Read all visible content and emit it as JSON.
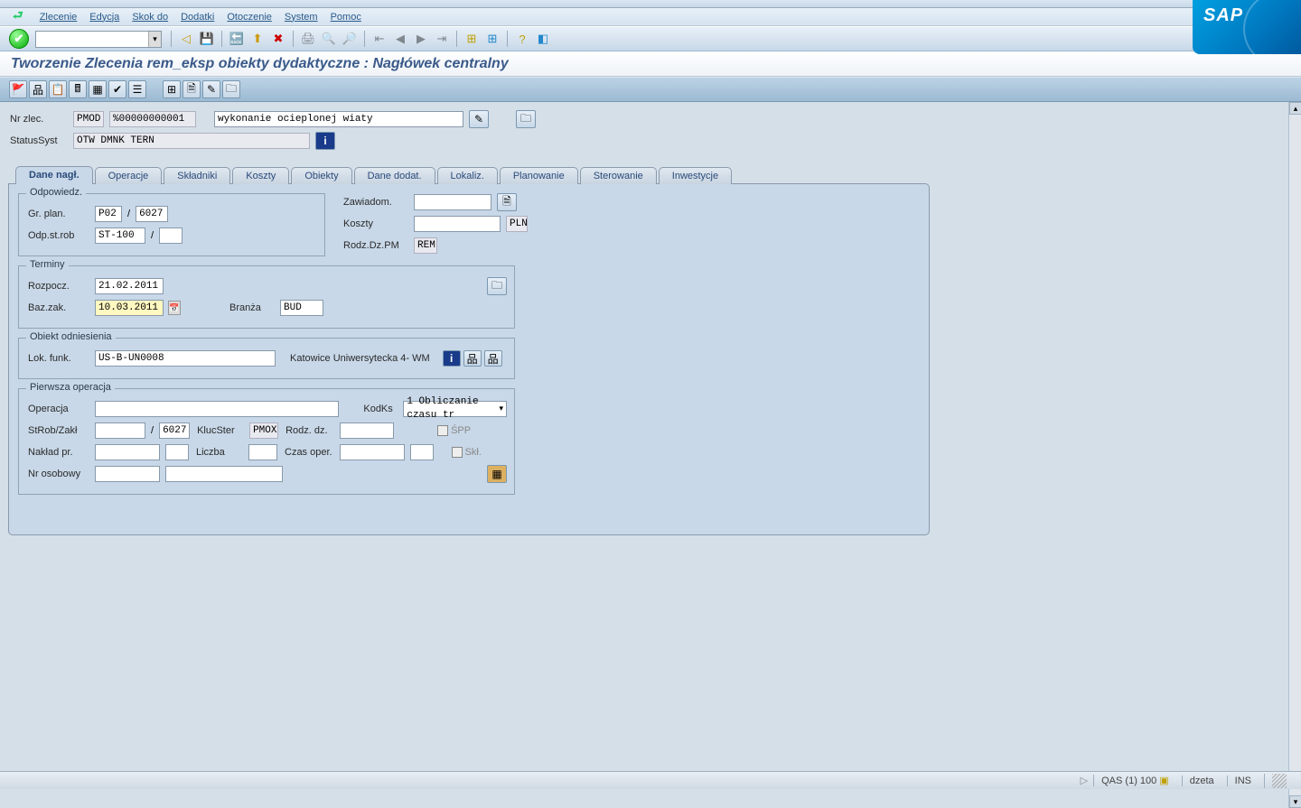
{
  "menu": {
    "items": [
      "Zlecenie",
      "Edycja",
      "Skok do",
      "Dodatki",
      "Otoczenie",
      "System",
      "Pomoc"
    ]
  },
  "page_title": "Tworzenie Zlecenia rem_eksp obiekty dydaktyczne : Nagłówek centralny",
  "header": {
    "nr_zlec_label": "Nr zlec.",
    "nr_zlec_type": "PMOD",
    "nr_zlec_num": "%00000000001",
    "nr_zlec_desc": "wykonanie ocieplonej wiaty",
    "status_label": "StatusSyst",
    "status_value": "OTW  DMNK TERN"
  },
  "tabs": [
    "Dane nagł.",
    "Operacje",
    "Składniki",
    "Koszty",
    "Obiekty",
    "Dane dodat.",
    "Lokaliz.",
    "Planowanie",
    "Sterowanie",
    "Inwestycje"
  ],
  "odpowiedz": {
    "title": "Odpowiedz.",
    "gr_plan_label": "Gr. plan.",
    "gr_plan_1": "P02",
    "gr_plan_2": "6027",
    "odp_strob_label": "Odp.st.rob",
    "odp_strob_1": "ST-100"
  },
  "right_info": {
    "zawiadom_label": "Zawiadom.",
    "koszty_label": "Koszty",
    "koszty_curr": "PLN",
    "rodz_label": "Rodz.Dz.PM",
    "rodz_val": "REM"
  },
  "terminy": {
    "title": "Terminy",
    "rozp_label": "Rozpocz.",
    "rozp_val": "21.02.2011",
    "baz_label": "Baz.zak.",
    "baz_val": "10.03.2011",
    "branza_label": "Branża",
    "branza_val": "BUD"
  },
  "obiekt": {
    "title": "Obiekt odniesienia",
    "lok_label": "Lok. funk.",
    "lok_val": "US-B-UN0008",
    "lok_desc": "Katowice Uniwersytecka 4- WM"
  },
  "pierwsza": {
    "title": "Pierwsza operacja",
    "operacja_label": "Operacja",
    "kodks_label": "KodKs",
    "kodks_val": "1 Obliczanie czasu tr",
    "strob_label": "StRob/Zakł",
    "strob_2": "6027",
    "klucster_label": "KlucSter",
    "klucster_val": "PMOX",
    "rodz_dz_label": "Rodz. dz.",
    "spp_label": "ŚPP",
    "naklad_label": "Nakład pr.",
    "liczba_label": "Liczba",
    "czas_label": "Czas oper.",
    "skl_label": "Skł.",
    "nr_osobowy_label": "Nr osobowy"
  },
  "status": {
    "sys": "QAS (1) 100",
    "server": "dzeta",
    "mode": "INS"
  }
}
